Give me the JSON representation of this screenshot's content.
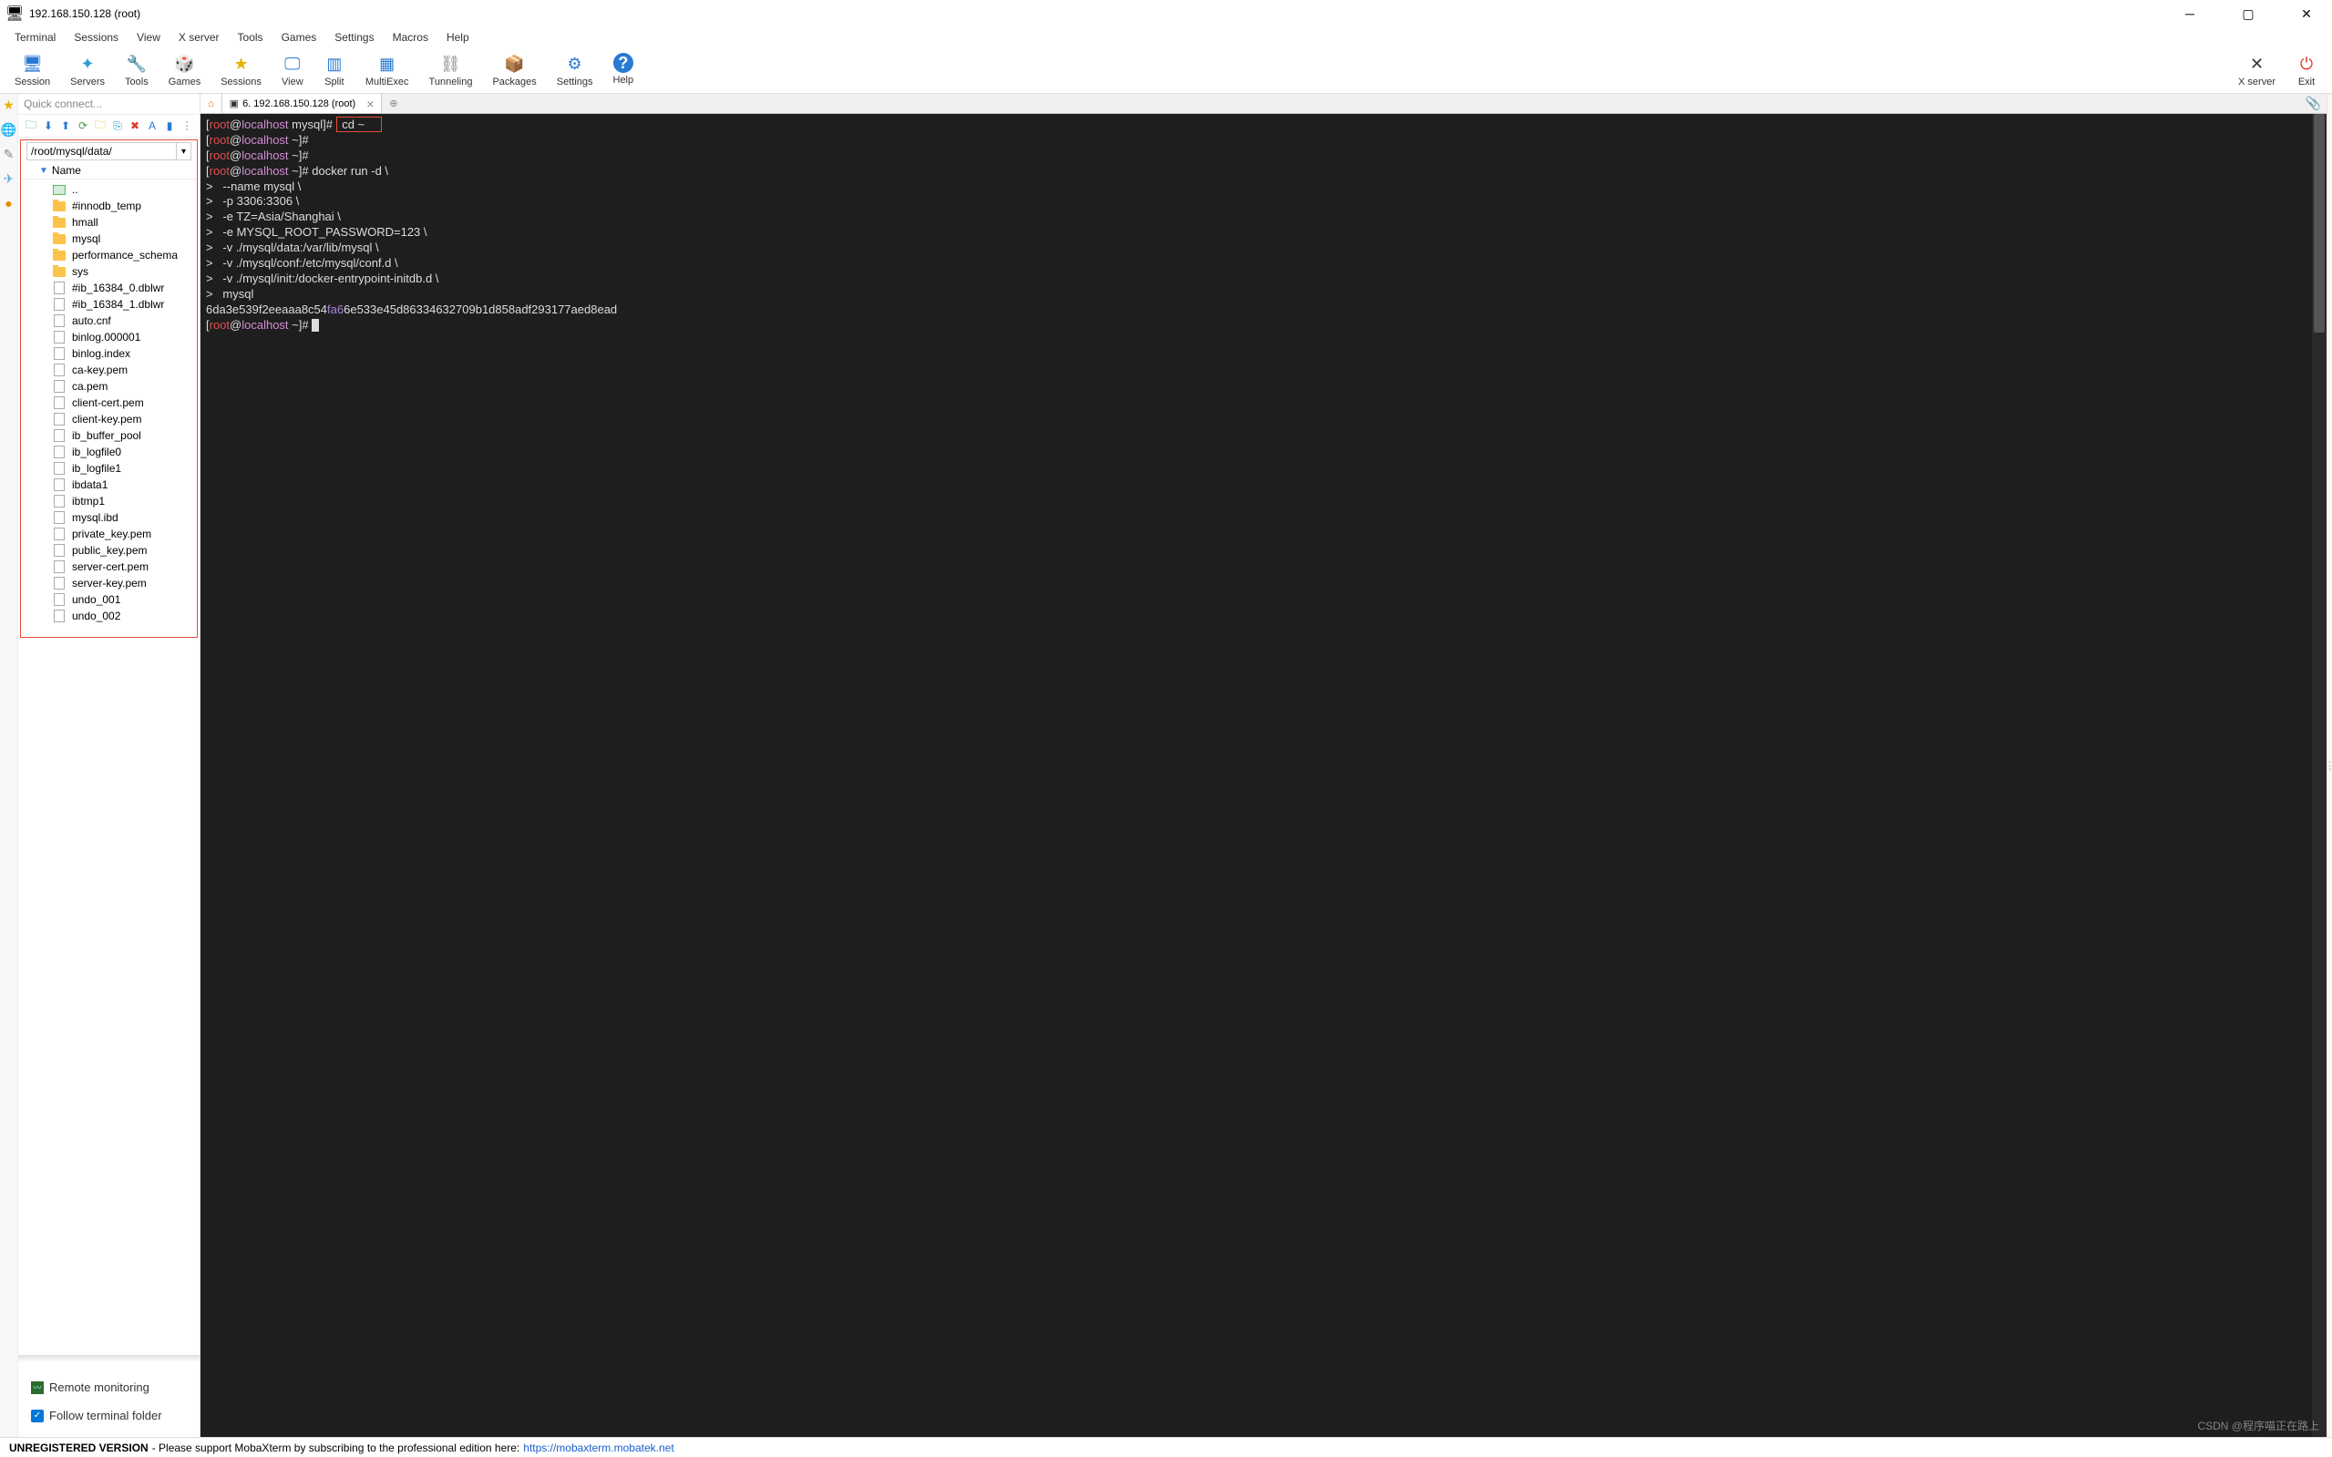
{
  "window": {
    "title": "192.168.150.128 (root)"
  },
  "menu": [
    "Terminal",
    "Sessions",
    "View",
    "X server",
    "Tools",
    "Games",
    "Settings",
    "Macros",
    "Help"
  ],
  "toolbar": [
    {
      "label": "Session",
      "icon": "🖥",
      "color": "#2a7ad4"
    },
    {
      "label": "Servers",
      "icon": "✦",
      "color": "#2a9ed4"
    },
    {
      "label": "Tools",
      "icon": "🔧",
      "color": "#d46a2a"
    },
    {
      "label": "Games",
      "icon": "🎲",
      "color": "#4aa03a"
    },
    {
      "label": "Sessions",
      "icon": "★",
      "color": "#e8b000"
    },
    {
      "label": "View",
      "icon": "🖵",
      "color": "#2a7ad4"
    },
    {
      "label": "Split",
      "icon": "▥",
      "color": "#2a7ad4"
    },
    {
      "label": "MultiExec",
      "icon": "▦",
      "color": "#2a7ad4"
    },
    {
      "label": "Tunneling",
      "icon": "⛓",
      "color": "#7d7d7d"
    },
    {
      "label": "Packages",
      "icon": "📦",
      "color": "#9a6b3a"
    },
    {
      "label": "Settings",
      "icon": "⚙",
      "color": "#2a7ad4"
    },
    {
      "label": "Help",
      "icon": "?",
      "color": "#fff",
      "bg": "#2a7ad4"
    }
  ],
  "toolbar_right": [
    {
      "label": "X server",
      "icon": "✕",
      "color": "#333"
    },
    {
      "label": "Exit",
      "icon": "⏻",
      "color": "#e03a2a"
    }
  ],
  "sidebar": {
    "quick_connect": "Quick connect...",
    "path": "/root/mysql/data/",
    "name_header": "Name",
    "items": [
      {
        "name": "..",
        "type": "up"
      },
      {
        "name": "#innodb_temp",
        "type": "folder"
      },
      {
        "name": "hmall",
        "type": "folder"
      },
      {
        "name": "mysql",
        "type": "folder"
      },
      {
        "name": "performance_schema",
        "type": "folder"
      },
      {
        "name": "sys",
        "type": "folder"
      },
      {
        "name": "#ib_16384_0.dblwr",
        "type": "file"
      },
      {
        "name": "#ib_16384_1.dblwr",
        "type": "file"
      },
      {
        "name": "auto.cnf",
        "type": "file"
      },
      {
        "name": "binlog.000001",
        "type": "file"
      },
      {
        "name": "binlog.index",
        "type": "file"
      },
      {
        "name": "ca-key.pem",
        "type": "file"
      },
      {
        "name": "ca.pem",
        "type": "file"
      },
      {
        "name": "client-cert.pem",
        "type": "file"
      },
      {
        "name": "client-key.pem",
        "type": "file"
      },
      {
        "name": "ib_buffer_pool",
        "type": "file"
      },
      {
        "name": "ib_logfile0",
        "type": "file"
      },
      {
        "name": "ib_logfile1",
        "type": "file"
      },
      {
        "name": "ibdata1",
        "type": "file"
      },
      {
        "name": "ibtmp1",
        "type": "file"
      },
      {
        "name": "mysql.ibd",
        "type": "file"
      },
      {
        "name": "private_key.pem",
        "type": "file"
      },
      {
        "name": "public_key.pem",
        "type": "file"
      },
      {
        "name": "server-cert.pem",
        "type": "file"
      },
      {
        "name": "server-key.pem",
        "type": "file"
      },
      {
        "name": "undo_001",
        "type": "file"
      },
      {
        "name": "undo_002",
        "type": "file"
      }
    ],
    "remote_monitoring": "Remote monitoring",
    "follow_terminal": "Follow terminal folder"
  },
  "tab": {
    "title": "6. 192.168.150.128 (root)"
  },
  "terminal": {
    "prompt_user": "root",
    "prompt_at": "@",
    "prompt_host": "localhost",
    "lines": [
      {
        "path": "mysql",
        "cmd": "cd ~",
        "boxed": true
      },
      {
        "path": "~",
        "cmd": ""
      },
      {
        "path": "~",
        "cmd": ""
      },
      {
        "path": "~",
        "cmd": "docker run -d \\"
      },
      {
        "cont": "   --name mysql \\"
      },
      {
        "cont": "   -p 3306:3306 \\"
      },
      {
        "cont": "   -e TZ=Asia/Shanghai \\"
      },
      {
        "cont": "   -e MYSQL_ROOT_PASSWORD=123 \\"
      },
      {
        "cont": "   -v ./mysql/data:/var/lib/mysql \\"
      },
      {
        "cont": "   -v ./mysql/conf:/etc/mysql/conf.d \\"
      },
      {
        "cont": "   -v ./mysql/init:/docker-entrypoint-initdb.d \\"
      },
      {
        "cont": "   mysql"
      },
      {
        "raw": "6da3e539f2eeaaa8c54",
        "hash": "fa6",
        "raw2": "6e533e45d86334632709b1d858adf293177aed8ead"
      },
      {
        "path": "~",
        "cmd": "",
        "cursor": true
      }
    ]
  },
  "status": {
    "left": "UNREGISTERED VERSION",
    "mid": "  -   Please support MobaXterm by subscribing to the professional edition here:  ",
    "link": "https://mobaxterm.mobatek.net"
  },
  "watermark": "CSDN @程序喵正在路上"
}
